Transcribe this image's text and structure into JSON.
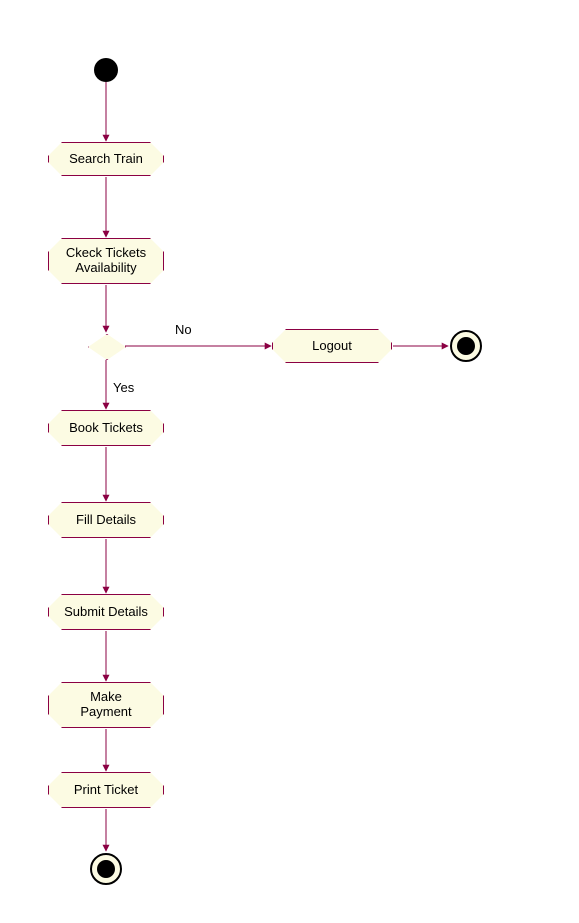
{
  "diagram": {
    "type": "uml-activity",
    "initial": true,
    "finals": 2,
    "activities": {
      "search_train": "Search Train",
      "check_tickets": "Ckeck Tickets\nAvailability",
      "logout": "Logout",
      "book_tickets": "Book Tickets",
      "fill_details": "Fill Details",
      "submit_details": "Submit Details",
      "make_payment": "Make\nPayment",
      "print_ticket": "Print Ticket"
    },
    "decision": {
      "no_label": "No",
      "yes_label": "Yes"
    },
    "colors": {
      "node_fill": "#fcfbe3",
      "node_border": "#8b0043",
      "edge": "#8b0043"
    }
  }
}
